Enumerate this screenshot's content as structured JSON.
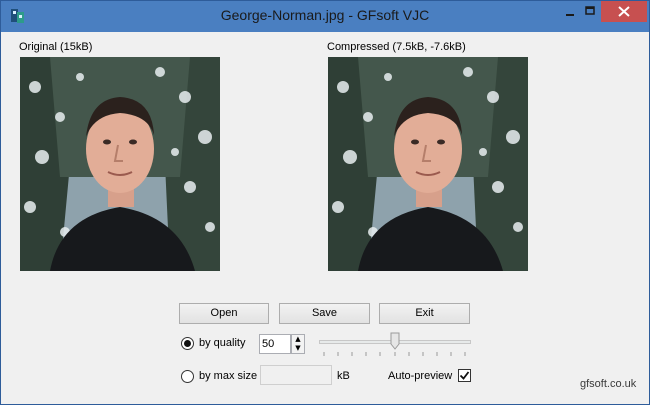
{
  "window": {
    "title": "George-Norman.jpg - GFsoft VJC"
  },
  "original": {
    "caption": "Original (15kB)"
  },
  "compressed": {
    "caption": "Compressed (7.5kB, -7.6kB)"
  },
  "buttons": {
    "open": "Open",
    "save": "Save",
    "exit": "Exit"
  },
  "quality": {
    "label": "by quality",
    "value": "50",
    "selected": true,
    "slider_level": 50,
    "slider_min": 0,
    "slider_max": 100
  },
  "max_size": {
    "label": "by max size",
    "value": "",
    "unit": "kB",
    "selected": false
  },
  "auto_preview": {
    "label": "Auto-preview",
    "checked": true
  },
  "footer": {
    "brand": "gfsoft.co.uk"
  },
  "icons": {
    "app": "app-icon",
    "minimize": "minimize-icon",
    "maximize": "maximize-icon",
    "close": "close-icon",
    "spin_up": "spin-up-icon",
    "spin_down": "spin-down-icon",
    "slider": "slider-thumb-icon",
    "check": "checkmark-icon"
  },
  "colors": {
    "titlebar": "#4a7fc1",
    "close_button": "#c75050",
    "window_bg": "#f0f0f0"
  }
}
